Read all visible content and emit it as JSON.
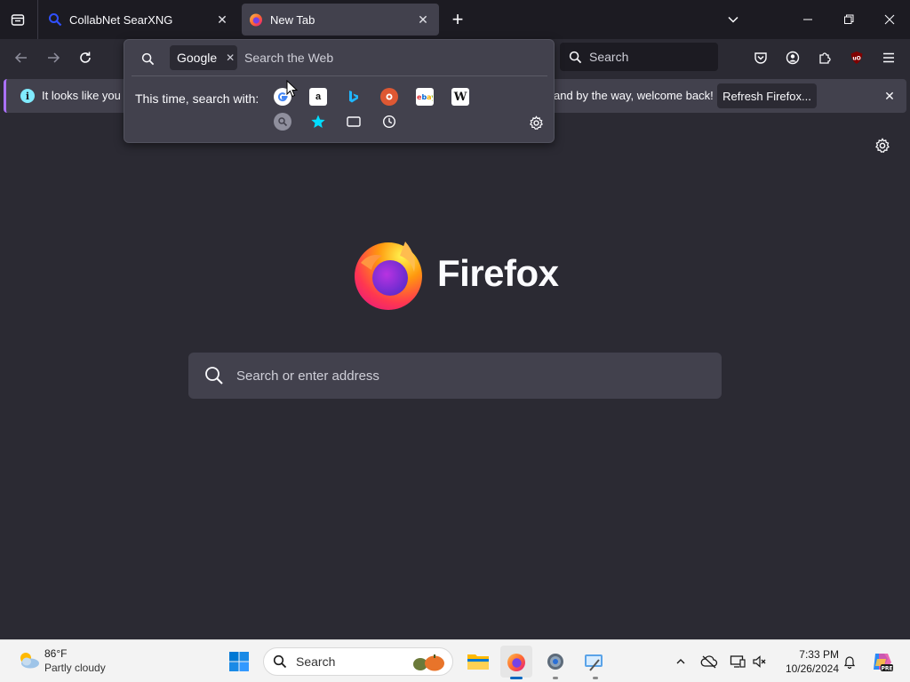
{
  "tabs": [
    {
      "title": "CollabNet SearXNG",
      "favicon": "searxng-search-icon",
      "active": false
    },
    {
      "title": "New Tab",
      "favicon": "firefox-logo-icon",
      "active": true
    }
  ],
  "navbar": {
    "search_placeholder": "Search"
  },
  "urlbar_popup": {
    "engine_chip": "Google",
    "input_placeholder": "Search the Web",
    "search_with_label": "This time, search with:",
    "engines_row1": [
      "google-icon",
      "amazon-icon",
      "bing-icon",
      "duckduckgo-icon",
      "ebay-icon",
      "wikipedia-icon"
    ],
    "engines_row2": [
      "searxng-icon",
      "bookmarks-star-icon",
      "tabs-icon",
      "history-icon"
    ]
  },
  "notification": {
    "text_left": "It looks like you ha",
    "text_right": "and by the way, welcome back!",
    "button": "Refresh Firefox..."
  },
  "newtab": {
    "wordmark": "Firefox",
    "search_placeholder": "Search or enter address"
  },
  "taskbar": {
    "weather_temp": "86°F",
    "weather_desc": "Partly cloudy",
    "search_label": "Search",
    "time": "7:33 PM",
    "date": "10/26/2024"
  },
  "colors": {
    "tab_strip": "#1c1b22",
    "toolbar": "#2b2a33",
    "panel": "#42414d",
    "accent": "#ab71ff",
    "taskbar": "#f3f3f3"
  }
}
